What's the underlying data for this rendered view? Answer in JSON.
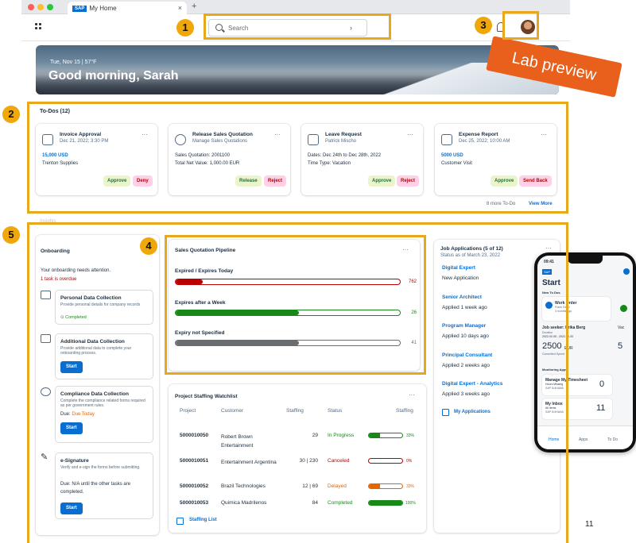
{
  "browser": {
    "tab_title": "My Home",
    "sap_badge": "SAP"
  },
  "search": {
    "placeholder": "Search"
  },
  "callouts": [
    "1",
    "2",
    "3",
    "4",
    "5"
  ],
  "hero": {
    "date": "Tue, Nov 15 | 57°F",
    "greeting": "Good morning, Sarah"
  },
  "lab_preview": "Lab preview",
  "todos": {
    "title": "To-Dos (12)",
    "cards": [
      {
        "title": "Invoice Approval",
        "sub": "Dec 21, 2022; 3:30 PM",
        "line1": "15,000 USD",
        "line2": "Trenton Supplies",
        "actions": [
          "Approve",
          "Deny"
        ]
      },
      {
        "title": "Release Sales Quotation",
        "sub": "Manage Sales Quotations",
        "line1": "Sales Quotation: 2001100",
        "line2": "Total Net Value: 1,000.00 EUR",
        "actions": [
          "Release",
          "Reject"
        ]
      },
      {
        "title": "Leave Request",
        "sub": "Patrick Mischo",
        "line1": "Dates: Dec 24th to Dec 28th, 2022",
        "line2": "Time Type: Vacation",
        "actions": [
          "Approve",
          "Reject"
        ]
      },
      {
        "title": "Expense Report",
        "sub": "Dec 25, 2022; 10:00 AM",
        "line1": "5000 USD",
        "line2": "Customer Visit",
        "actions": [
          "Approve",
          "Send Back"
        ]
      }
    ],
    "more_text": "8 more To-Do",
    "view_more": "View More"
  },
  "faint_label": "Insights",
  "onboarding": {
    "title": "Onboarding",
    "attention": "Your onboarding needs attention.",
    "overdue": "1 task is overdue",
    "tasks": [
      {
        "title": "Personal Data Collection",
        "desc": "Provide personal details for company records",
        "status": "Completed"
      },
      {
        "title": "Additional Data Collection",
        "desc": "Provide additional data to complete your onboarding process.",
        "button": "Start"
      },
      {
        "title": "Compliance Data Collection",
        "desc": "Complete the compliance related forms required as per government rules.",
        "due_label": "Due:",
        "due_value": "Due Today",
        "button": "Start"
      },
      {
        "title": "e-Signature",
        "desc": "Verify and e-sign the forms before submitting.",
        "due_text": "Due: N/A until the other tasks are completed.",
        "button": "Start"
      }
    ]
  },
  "pipeline": {
    "title": "Sales Quotation Pipeline",
    "more": "···",
    "rows": [
      {
        "label": "Expired / Expires Today",
        "value": "762",
        "fraction": 0.12,
        "color": "#bb0000"
      },
      {
        "label": "Expires after a Week",
        "value": "26",
        "fraction": 0.55,
        "color": "#188918"
      },
      {
        "label": "Expiry not Specified",
        "value": "41",
        "fraction": 0.55,
        "color": "#6a6d70"
      }
    ]
  },
  "staffing": {
    "title": "Project Staffing Watchlist",
    "more": "···",
    "headers": [
      "Project",
      "Customer",
      "Staffing",
      "Status",
      "Staffing"
    ],
    "rows": [
      {
        "project": "5000010050",
        "customer": "Robert Brown Entertainment",
        "staffing": "29",
        "status": "In Progress",
        "status_color": "#188918",
        "pct": "33%",
        "fraction": 0.33,
        "bar_color": "#188918"
      },
      {
        "project": "5000010051",
        "customer": "Entertainment Argentina",
        "staffing": "30 | 230",
        "status": "Canceled",
        "status_color": "#bb0000",
        "pct": "0%",
        "fraction": 0.0,
        "bar_color": "#bb0000"
      },
      {
        "project": "5000010052",
        "customer": "Brazil Technologies",
        "staffing": "12 | 69",
        "status": "Delayed",
        "status_color": "#e76500",
        "pct": "33%",
        "fraction": 0.33,
        "bar_color": "#e76500"
      },
      {
        "project": "5000010053",
        "customer": "Quimica Madrilenos",
        "staffing": "84",
        "status": "Completed",
        "status_color": "#188918",
        "pct": "100%",
        "fraction": 1.0,
        "bar_color": "#188918"
      }
    ],
    "link": "Staffing List"
  },
  "jobs": {
    "title": "Job Applications (5 of 12)",
    "status": "Status as of March 23, 2022",
    "more": "···",
    "items": [
      {
        "title": "Digital Expert",
        "sub": "New Application"
      },
      {
        "title": "Senior Architect",
        "sub": "Applied 1 week ago"
      },
      {
        "title": "Program Manager",
        "sub": "Applied 10 days ago"
      },
      {
        "title": "Principal Consultant",
        "sub": "Applied 2 weeks ago"
      },
      {
        "title": "Digital Expert  - Analytics",
        "sub": "Applied 3 weeks ago"
      }
    ],
    "link": "My Applications"
  },
  "phone": {
    "time": "09:41",
    "title": "Start",
    "new_todos": "New To Dos",
    "work_order": "Work Order",
    "frank": "Frank Gadd",
    "months": "3 months ago",
    "job_seeker": "Job seeker: Erika Berg",
    "duration": "Duration",
    "dates": "2022-02-05 - 2022-03-30",
    "amount": "2500",
    "currency": "EUR",
    "committed": "Committed Spend",
    "partial_vac": "Vac",
    "partial_five": "5",
    "monitoring": "Monitoring Apps",
    "timesheet": "Manage My Timesheet",
    "hours": "Hours Missing",
    "sap1": "SAP S/4HANA",
    "zero": "0",
    "inbox": "My Inbox",
    "all_items": "All Items",
    "sap2": "SAP S/4HANA",
    "eleven": "11",
    "nav": [
      "Home",
      "Apps",
      "To Do"
    ]
  },
  "page_number": "11"
}
